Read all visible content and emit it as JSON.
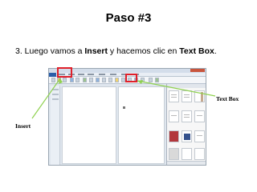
{
  "slide": {
    "title": "Paso #3",
    "instruction": {
      "prefix": "3. Luego vamos a ",
      "insert_word": "Insert",
      "middle": " y hacemos clic en ",
      "textbox_word": "Text Box",
      "suffix": "."
    }
  },
  "labels": {
    "text_box": "Text Box",
    "insert": "Insert"
  },
  "colors": {
    "highlight": "#e0202a",
    "arrow": "#8fd14f",
    "file_tab": "#2a5ea8"
  }
}
